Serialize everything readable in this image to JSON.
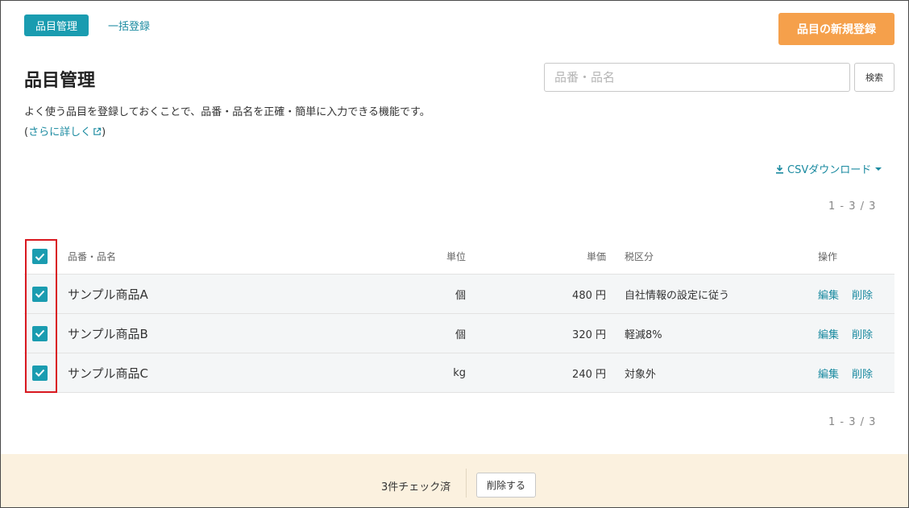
{
  "tabs": [
    {
      "label": "品目管理",
      "active": true
    },
    {
      "label": "一括登録",
      "active": false
    }
  ],
  "new_button": "品目の新規登録",
  "page_title": "品目管理",
  "search": {
    "placeholder": "品番・品名",
    "value": "",
    "button": "検索"
  },
  "description": "よく使う品目を登録しておくことで、品番・品名を正確・簡単に入力できる機能です。",
  "more_link": {
    "prefix": "(",
    "label": "さらに詳しく",
    "suffix": ")"
  },
  "csv_download": "CSVダウンロード",
  "pagination": "1 - 3 / 3",
  "table": {
    "headers": {
      "name": "品番・品名",
      "unit": "単位",
      "price": "単価",
      "tax": "税区分",
      "ops": "操作"
    },
    "rows": [
      {
        "name": "サンプル商品A",
        "unit": "個",
        "price": "480 円",
        "tax": "自社情報の設定に従う",
        "edit": "編集",
        "delete": "削除",
        "checked": true
      },
      {
        "name": "サンプル商品B",
        "unit": "個",
        "price": "320 円",
        "tax": "軽減8%",
        "edit": "編集",
        "delete": "削除",
        "checked": true
      },
      {
        "name": "サンプル商品C",
        "unit": "kg",
        "price": "240 円",
        "tax": "対象外",
        "edit": "編集",
        "delete": "削除",
        "checked": true
      }
    ]
  },
  "footer": {
    "checked_count": "3件チェック済",
    "delete_button": "削除する"
  },
  "colors": {
    "accent": "#1a9cb0",
    "primary_button": "#f5a04b",
    "link": "#1a8aa0",
    "footer_bg": "#fbf1df",
    "highlight": "#d9181f"
  }
}
